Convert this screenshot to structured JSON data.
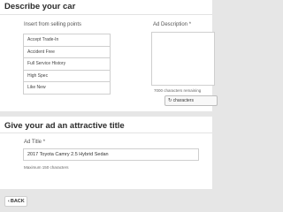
{
  "describe": {
    "heading": "Describe your car",
    "selling_points_label": "Insert from selling points",
    "selling_points": [
      "Accept Trade-In",
      "Accident Free",
      "Full Service History",
      "High Spec",
      "Like New"
    ],
    "ad_description_label": "Ad Description",
    "required_marker": "*",
    "ad_description_value": "",
    "chars_remaining": "7000 characters remaining",
    "check_button_label": "characters"
  },
  "title_section": {
    "heading": "Give your ad an attractive title",
    "ad_title_label": "Ad Title",
    "required_marker": "*",
    "ad_title_value": "2017 Toyota Camry 2.5 Hybrid Sedan",
    "max_chars": "Maximum 150 characters"
  },
  "footer": {
    "back_label": "BACK",
    "back_icon": "chevron-left-icon"
  }
}
